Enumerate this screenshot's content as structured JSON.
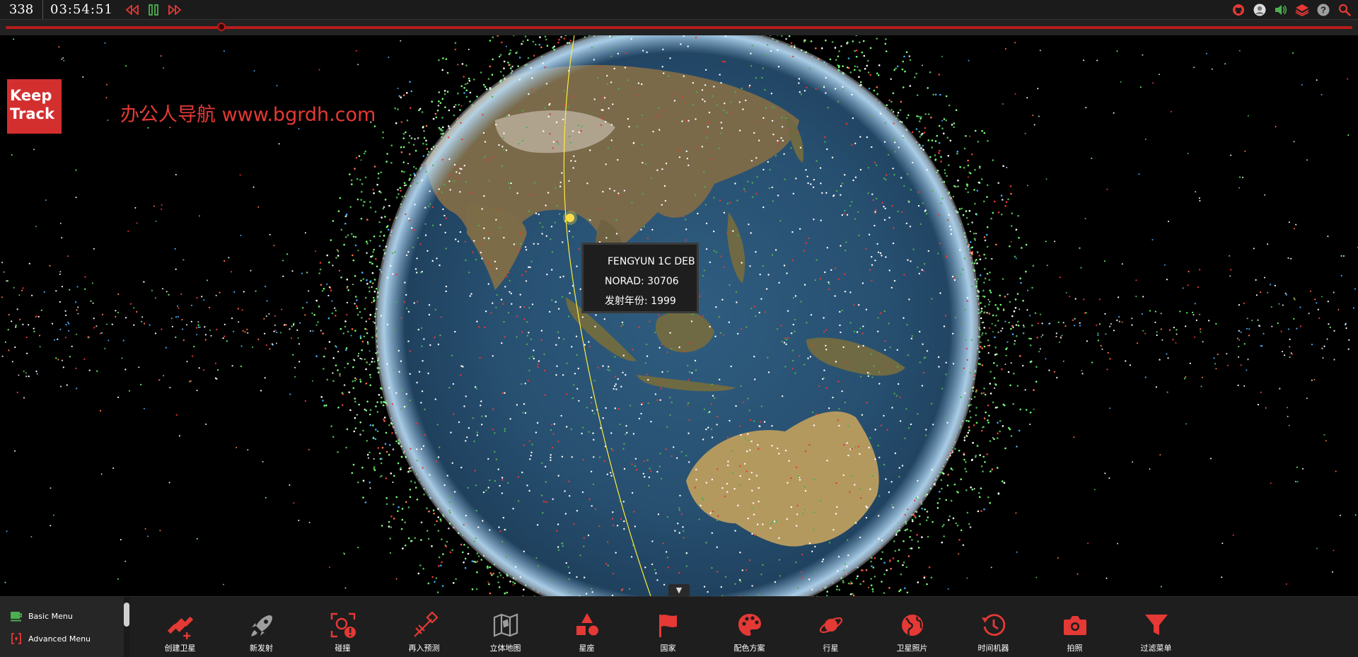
{
  "topbar": {
    "satellite_count": "338",
    "clock": "03:54:51",
    "timeline_progress": 0.16
  },
  "colors": {
    "accent": "#e53935",
    "bar_bg": "#1b1b1b",
    "play_green": "#4caf50",
    "tooltip_bg": "#1e1e1e"
  },
  "logo": {
    "line1": "Keep",
    "line2": "Track"
  },
  "watermark": "办公人导航 www.bgrdh.com",
  "tooltip": {
    "name": "FENGYUN 1C DEB",
    "norad": "NORAD: 30706",
    "launch_year": "发射年份: 1999"
  },
  "menus": {
    "basic": "Basic Menu",
    "advanced": "Advanced Menu"
  },
  "toolbar": [
    {
      "label": "创建卫星",
      "icon": "satellite-add-icon"
    },
    {
      "label": "新发射",
      "icon": "rocket-icon"
    },
    {
      "label": "碰撞",
      "icon": "collision-target-icon"
    },
    {
      "label": "再入预测",
      "icon": "reentry-satellite-icon"
    },
    {
      "label": "立体地图",
      "icon": "map-icon"
    },
    {
      "label": "星座",
      "icon": "shapes-icon"
    },
    {
      "label": "国家",
      "icon": "flag-icon"
    },
    {
      "label": "配色方案",
      "icon": "palette-icon"
    },
    {
      "label": "行星",
      "icon": "planet-icon"
    },
    {
      "label": "卫星照片",
      "icon": "globe-icon"
    },
    {
      "label": "时间机器",
      "icon": "history-icon"
    },
    {
      "label": "拍照",
      "icon": "camera-icon"
    },
    {
      "label": "过滤菜单",
      "icon": "filter-icon"
    }
  ]
}
